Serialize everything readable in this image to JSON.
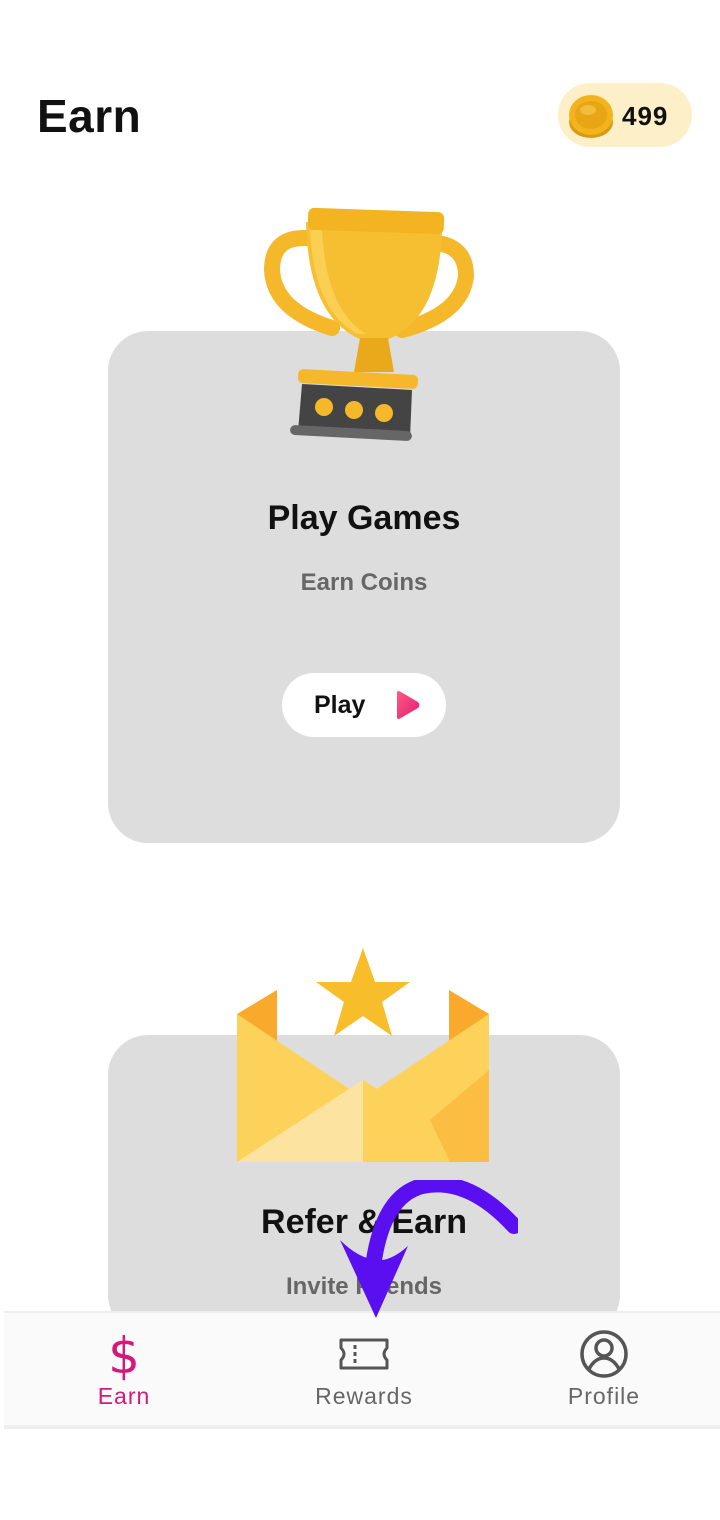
{
  "header": {
    "title": "Earn",
    "coin_balance": "499",
    "coin_icon": "coin-icon"
  },
  "cards": [
    {
      "illustration": "trophy-icon",
      "title": "Play Games",
      "subtitle": "Earn Coins",
      "button_label": "Play",
      "button_icon": "play-icon"
    },
    {
      "illustration": "envelope-star-icon",
      "title": "Refer & Earn",
      "subtitle": "Invite Friends"
    }
  ],
  "tabs": [
    {
      "label": "Earn",
      "icon": "dollar-icon",
      "active": true
    },
    {
      "label": "Rewards",
      "icon": "ticket-icon",
      "active": false
    },
    {
      "label": "Profile",
      "icon": "user-circle-icon",
      "active": false
    }
  ],
  "colors": {
    "accent": "#d4187c",
    "inactive": "#666666",
    "card_bg": "#dddddd",
    "coin_badge_bg": "#fdf0c8",
    "annotation_arrow": "#5a0ff0"
  }
}
